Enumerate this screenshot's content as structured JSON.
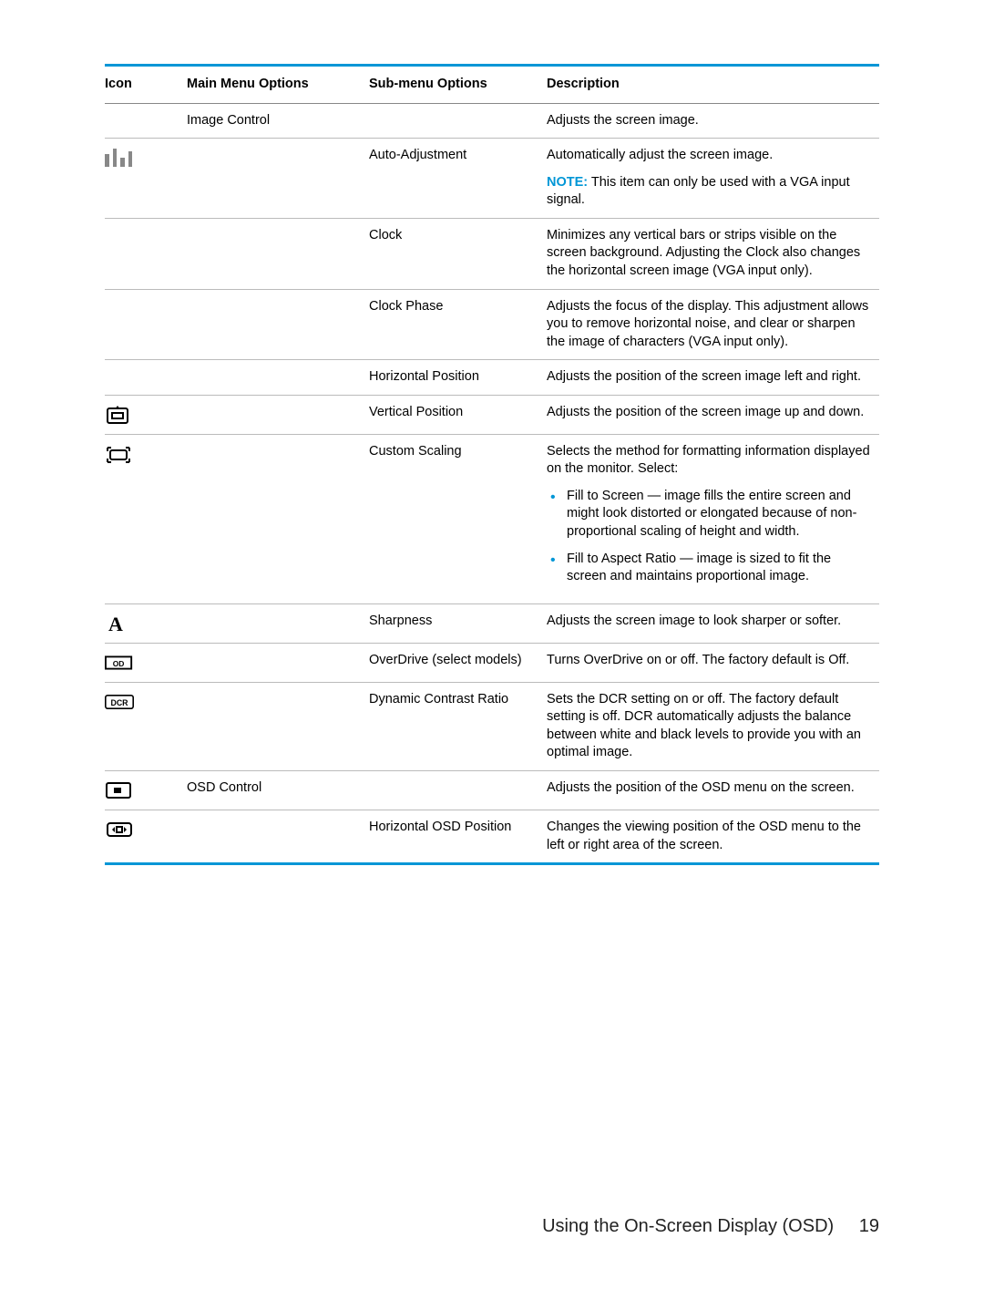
{
  "headers": {
    "icon": "Icon",
    "main": "Main Menu Options",
    "sub": "Sub-menu Options",
    "desc": "Description"
  },
  "note_label": "NOTE:",
  "rows": [
    {
      "icon": "gradient",
      "main": "Image Control",
      "sub": "",
      "desc": "Adjusts the screen image."
    },
    {
      "icon": "bars",
      "main": "",
      "sub": "Auto-Adjustment",
      "desc": "Automatically adjust the screen image.",
      "note": "This item can only be used with a VGA input signal."
    },
    {
      "icon": "",
      "main": "",
      "sub": "Clock",
      "desc": "Minimizes any vertical bars or strips visible on the screen background. Adjusting the Clock also changes the horizontal screen image (VGA input only)."
    },
    {
      "icon": "",
      "main": "",
      "sub": "Clock Phase",
      "desc": "Adjusts the focus of the display. This adjustment allows you to remove horizontal noise, and clear or sharpen the image of characters (VGA input only)."
    },
    {
      "icon": "",
      "main": "",
      "sub": "Horizontal Position",
      "desc": "Adjusts the position of the screen image left and right."
    },
    {
      "icon": "vpos",
      "main": "",
      "sub": "Vertical Position",
      "desc": "Adjusts the position of the screen image up and down."
    },
    {
      "icon": "scale",
      "main": "",
      "sub": "Custom Scaling",
      "desc": "Selects the method for formatting information displayed on the monitor. Select:",
      "bullets": [
        "Fill to Screen — image fills the entire screen and might look distorted or elongated because of non-proportional scaling of height and width.",
        "Fill to Aspect Ratio — image is sized to fit the screen and maintains proportional image."
      ]
    },
    {
      "icon": "sharp",
      "main": "",
      "sub": "Sharpness",
      "desc": "Adjusts the screen image to look sharper or softer."
    },
    {
      "icon": "od",
      "main": "",
      "sub": "OverDrive (select models)",
      "desc": "Turns OverDrive on or off. The factory default is Off."
    },
    {
      "icon": "dcr",
      "main": "",
      "sub": "Dynamic Contrast Ratio",
      "desc": "Sets the DCR setting on or off. The factory default setting is off. DCR automatically adjusts the balance between white and black levels to provide you with an optimal image."
    },
    {
      "icon": "osd",
      "main": "OSD Control",
      "sub": "",
      "desc": "Adjusts the position of the OSD menu on the screen."
    },
    {
      "icon": "hosd",
      "main": "",
      "sub": "Horizontal OSD Position",
      "desc": "Changes the viewing position of the OSD menu to the left or right area of the screen."
    }
  ],
  "footer": {
    "label": "Using the On-Screen Display (OSD)",
    "page": "19"
  },
  "icon_text": {
    "od": "OD",
    "dcr": "DCR"
  }
}
